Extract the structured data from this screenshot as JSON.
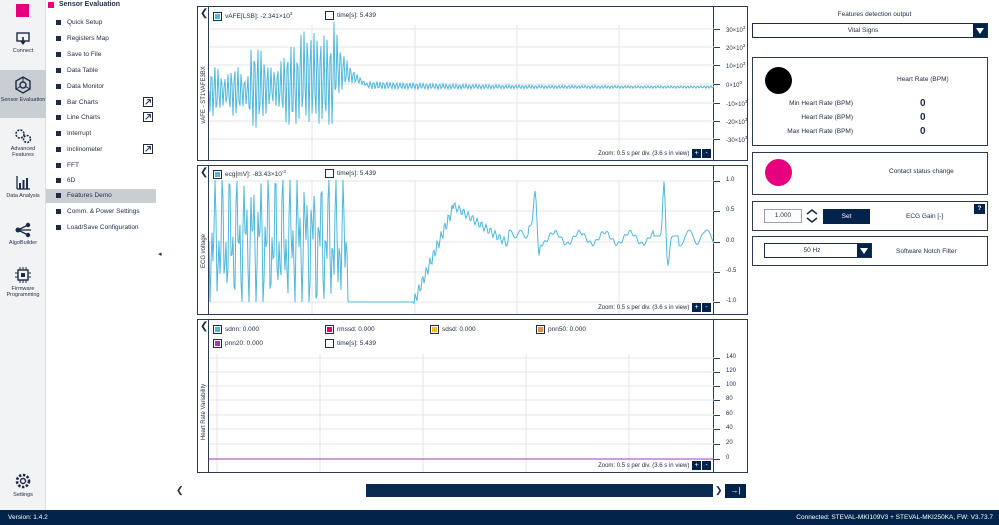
{
  "app": {
    "section_title": "Sensor Evaluation",
    "version": "Version: 1.4.2",
    "connection": "Connected:  STEVAL-MKI109V3 + STEVAL-MKI250KA, FW: V3.73.7"
  },
  "rail": [
    {
      "label": "Connect",
      "icon": "connect-icon"
    },
    {
      "label": "Sensor Evaluation",
      "icon": "sensor-evaluation-icon"
    },
    {
      "label": "Advanced Features",
      "icon": "advanced-features-icon"
    },
    {
      "label": "Data Analysis",
      "icon": "data-analysis-icon"
    },
    {
      "label": "AlgoBuilder",
      "icon": "algobuilder-icon"
    },
    {
      "label": "Firmware Programming",
      "icon": "firmware-programming-icon"
    },
    {
      "label": "Settings",
      "icon": "settings-icon"
    }
  ],
  "nav": [
    {
      "label": "Quick Setup"
    },
    {
      "label": "Registers Map"
    },
    {
      "label": "Save to File"
    },
    {
      "label": "Data Table"
    },
    {
      "label": "Data Monitor"
    },
    {
      "label": "Bar Charts"
    },
    {
      "label": "Line Charts"
    },
    {
      "label": "Interrupt"
    },
    {
      "label": "Inclinometer"
    },
    {
      "label": "FFT"
    },
    {
      "label": "6D"
    },
    {
      "label": "Features Demo"
    },
    {
      "label": "Comm. & Power Settings"
    },
    {
      "label": "Load/Save Configuration"
    }
  ],
  "plot1": {
    "ytitle": "vAFE - ST1VAFE3BX",
    "legend_value": "vAFE[LSB]: -2.341×10",
    "legend_exp": "3",
    "time_label": "time[s]: 5.439",
    "zoom": "Zoom: 0.5 s per div. (3.6 s in view)",
    "ticks": [
      {
        "base": "30×10",
        "exp": "3"
      },
      {
        "base": "20×10",
        "exp": "3"
      },
      {
        "base": "10×10",
        "exp": "3"
      },
      {
        "base": "0×10",
        "exp": "0"
      },
      {
        "base": "-10×10",
        "exp": "3"
      },
      {
        "base": "-20×10",
        "exp": "3"
      },
      {
        "base": "-30×10",
        "exp": "3"
      }
    ]
  },
  "plot2": {
    "ytitle": "ECG voltage",
    "legend_value": "ecg[mV]: -83.43×10",
    "legend_exp": "-3",
    "time_label": "time[s]: 5.439",
    "zoom": "Zoom: 0.5 s per div. (3.6 s in view)",
    "ticks": [
      "1.0",
      "0.5",
      "0.0",
      "-0.5",
      "-1.0"
    ]
  },
  "plot3": {
    "ytitle": "Heart Rate Variability",
    "legend": [
      {
        "label": "sdnn: 0.000",
        "color": "#4fb8dc"
      },
      {
        "label": "rmssd: 0.000",
        "color": "#e6007e"
      },
      {
        "label": "sdsd: 0.000",
        "color": "#f5b91e"
      },
      {
        "label": "pnn50: 0.000",
        "color": "#f08a3c"
      },
      {
        "label": "pnn20: 0.000",
        "color": "#9b3bb8"
      }
    ],
    "time_label": "time[s]: 5.439",
    "zoom": "Zoom: 0.5 s per div. (3.6 s in view)",
    "ticks": [
      "140",
      "120",
      "100",
      "80",
      "60",
      "40",
      "20",
      "0"
    ]
  },
  "right": {
    "features_title": "Features detection output",
    "features_select": "Vital Signs",
    "heart_rate_title": "Heart Rate (BPM)",
    "rows": [
      {
        "label": "Min Heart Rate (BPM)",
        "value": "0"
      },
      {
        "label": "Heart Rate (BPM)",
        "value": "0"
      },
      {
        "label": "Max Heart Rate (BPM)",
        "value": "0"
      }
    ],
    "contact_label": "Contact status change",
    "gain_value": "1.000",
    "set_label": "Set",
    "gain_label": "ECG Gain [-]",
    "help_label": "?",
    "notch_value": "50 Hz",
    "notch_label": "Software Notch Filter"
  },
  "colors": {
    "accent": "#e6007e",
    "navy": "#03234b",
    "signal": "#4fb8dc"
  }
}
